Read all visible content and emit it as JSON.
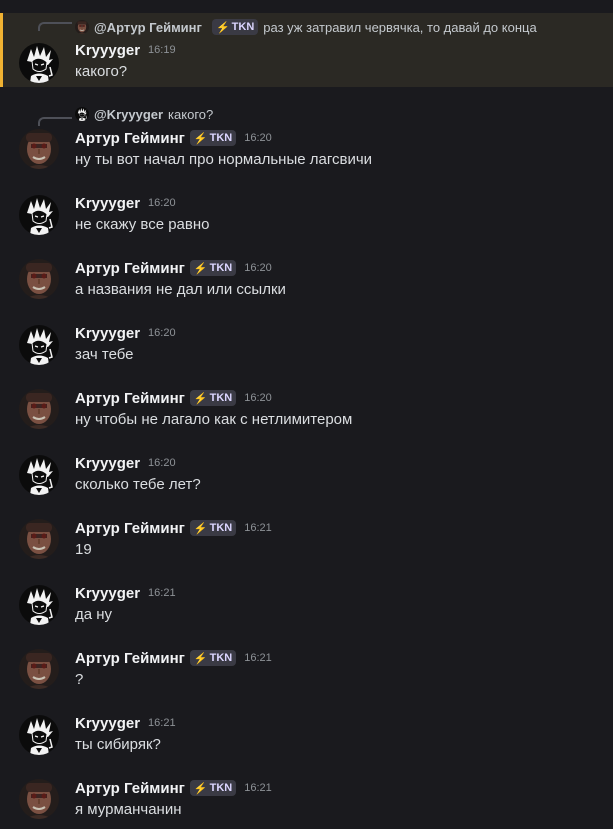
{
  "users": {
    "artur": {
      "name": "Артур Гейминг",
      "badge": "TKN",
      "mention": "@Артур Гейминг",
      "avatar_icon": "portrait-avatar-icon"
    },
    "kry": {
      "name": "Kryyyger",
      "mention": "@Kryyyger",
      "avatar_icon": "anime-avatar-icon"
    }
  },
  "first_reply": {
    "text": "раз уж затравил червячка, то давай до конца"
  },
  "second_reply": {
    "text": "какого?"
  },
  "messages": [
    {
      "author": "Kryyyger",
      "time": "16:19",
      "text": "какого?"
    },
    {
      "author": "Артур Гейминг",
      "time": "16:20",
      "text": "ну ты вот начал про нормальные лагсвичи"
    },
    {
      "author": "Kryyyger",
      "time": "16:20",
      "text": "не скажу все равно"
    },
    {
      "author": "Артур Гейминг",
      "time": "16:20",
      "text": "а названия не дал или ссылки"
    },
    {
      "author": "Kryyyger",
      "time": "16:20",
      "text": "зач тебе"
    },
    {
      "author": "Артур Гейминг",
      "time": "16:20",
      "text": "ну чтобы не лагало как с нетлимитером"
    },
    {
      "author": "Kryyyger",
      "time": "16:20",
      "text": "сколько тебе лет?"
    },
    {
      "author": "Артур Гейминг",
      "time": "16:21",
      "text": "19"
    },
    {
      "author": "Kryyyger",
      "time": "16:21",
      "text": "да ну"
    },
    {
      "author": "Артур Гейминг",
      "time": "16:21",
      "text": "?"
    },
    {
      "author": "Kryyyger",
      "time": "16:21",
      "text": "ты сибиряк?"
    },
    {
      "author": "Артур Гейминг",
      "time": "16:21",
      "text": "я мурманчанин"
    }
  ],
  "colors": {
    "background": "#1a1a1e",
    "highlight": "#2b2924",
    "highlight_bar": "#f0b232",
    "badge_bg": "#3a3a44",
    "badge_bolt": "#a78bfa"
  }
}
